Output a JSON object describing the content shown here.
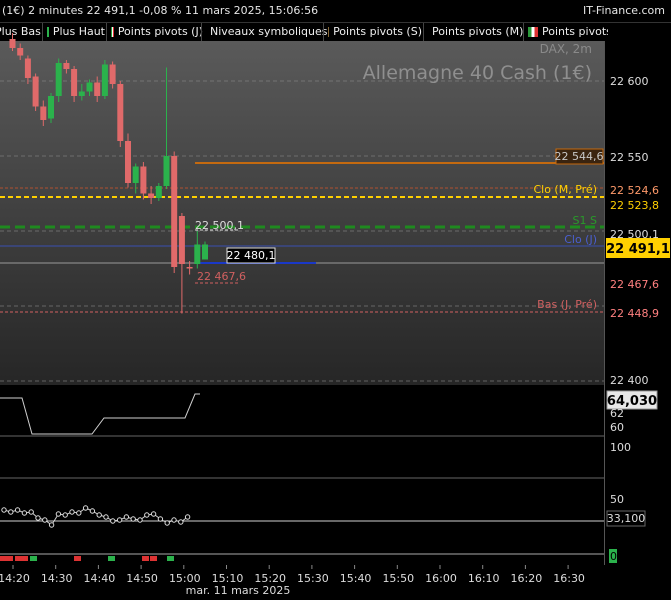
{
  "header": {
    "title": "(1€) 2 minutes 22 491,1 -0,08 % 11 mars 2025, 15:06:56",
    "brand": "IT-Finance.com"
  },
  "legend": [
    {
      "label": "Plus Bas",
      "swatch": "none"
    },
    {
      "label": "Plus Haut",
      "swatch": "green"
    },
    {
      "label": "Points pivots (J)",
      "swatch": "it"
    },
    {
      "label": "Niveaux symboliques",
      "swatch": "grey"
    },
    {
      "label": "Points pivots (S)",
      "swatch": "it"
    },
    {
      "label": "Points pivots (M)",
      "swatch": "it"
    },
    {
      "label": "Points pivots",
      "swatch": "it"
    }
  ],
  "chart": {
    "watermark_small": "DAX, 2m",
    "watermark_big": "Allemagne 40 Cash (1€)",
    "y_ticks": [
      "22 600",
      "22 550",
      "22 500",
      "22 450",
      "22 400"
    ],
    "price_tags": [
      {
        "text": "22 544,6",
        "color": "#c8c8c8",
        "bg": "#3a2410",
        "border": "#c46a10"
      },
      {
        "text": "22 524,6",
        "color": "#ff9a6a",
        "bg": "#000",
        "border": "none"
      },
      {
        "text": "22 523,8",
        "color": "#ffd000",
        "bg": "#000",
        "border": "none"
      },
      {
        "text": "22 500,1",
        "color": "#dddddd",
        "bg": "#000",
        "border": "none"
      },
      {
        "text": "22 491,1",
        "color": "#000000",
        "bg": "#ffd000",
        "border": "none"
      },
      {
        "text": "22 467,6",
        "color": "#ff8080",
        "bg": "#000",
        "border": "none"
      },
      {
        "text": "22 448,9",
        "color": "#ff8080",
        "bg": "#000",
        "border": "none"
      }
    ],
    "line_labels": {
      "clo": "Clo (M, Pré)",
      "s1": "S1 S",
      "clo_j": "Clo (J)",
      "bas": "Bas (J, Pré)",
      "hl_high": "22 500,1",
      "hl_low": "22 467,6",
      "current_box": "22 480,1"
    },
    "indicator1": {
      "value": "64,030",
      "ticks": [
        "62",
        "60"
      ]
    },
    "indicator2": {
      "ticks": [
        "100"
      ]
    },
    "indicator3": {
      "ticks": [
        "50"
      ],
      "value": "33,100"
    },
    "indicator4": {
      "ticks": [
        "0"
      ]
    },
    "x_ticks": [
      "14:20",
      "14:30",
      "14:40",
      "14:50",
      "15:00",
      "15:10",
      "15:20",
      "15:30",
      "15:40",
      "15:50",
      "16:00",
      "16:10",
      "16:20",
      "16:30"
    ],
    "date_label": "mar. 11 mars 2025",
    "colors": {
      "up": "#2bb24c",
      "down": "#e06a6a",
      "accent_yellow": "#ffd000",
      "pivot_green": "#1f8a1f",
      "blue_line": "#1a38c8"
    }
  },
  "chart_data": {
    "type": "candlestick",
    "title": "Allemagne 40 Cash (1€)",
    "subtitle": "DAX, 2m",
    "x": [
      "14:10",
      "14:12",
      "14:14",
      "14:16",
      "14:18",
      "14:20",
      "14:22",
      "14:24",
      "14:26",
      "14:28",
      "14:30",
      "14:32",
      "14:34",
      "14:36",
      "14:38",
      "14:40",
      "14:42",
      "14:44",
      "14:46",
      "14:48",
      "14:50",
      "14:52",
      "14:54",
      "14:56",
      "14:58",
      "15:00",
      "15:02",
      "15:04",
      "15:06"
    ],
    "open": [
      22625,
      22630,
      22632,
      22628,
      22622,
      22615,
      22603,
      22583,
      22575,
      22590,
      22612,
      22608,
      22590,
      22593,
      22599,
      22590,
      22611,
      22598,
      22560,
      22532,
      22543,
      22525,
      22522,
      22530,
      22550,
      22510,
      22476,
      22478,
      22481
    ],
    "close": [
      22632,
      22628,
      22632,
      22622,
      22617,
      22602,
      22583,
      22574,
      22590,
      22612,
      22608,
      22590,
      22593,
      22599,
      22590,
      22611,
      22598,
      22560,
      22532,
      22543,
      22525,
      22522,
      22530,
      22550,
      22476,
      22478,
      22475,
      22491,
      22491
    ],
    "high": [
      22635,
      22633,
      22635,
      22632,
      22625,
      22617,
      22605,
      22587,
      22592,
      22615,
      22614,
      22610,
      22598,
      22601,
      22603,
      22614,
      22613,
      22600,
      22565,
      22545,
      22546,
      22530,
      22532,
      22609,
      22553,
      22512,
      22480,
      22500,
      22493
    ],
    "low": [
      22622,
      22626,
      22628,
      22620,
      22614,
      22598,
      22580,
      22570,
      22572,
      22586,
      22605,
      22586,
      22587,
      22590,
      22586,
      22588,
      22595,
      22556,
      22529,
      22525,
      22521,
      22518,
      22520,
      22528,
      22472,
      22445,
      22471,
      22475,
      22489
    ],
    "ylim": [
      22395,
      22640
    ],
    "yticks": [
      22400,
      22450,
      22500,
      22550,
      22600
    ]
  }
}
